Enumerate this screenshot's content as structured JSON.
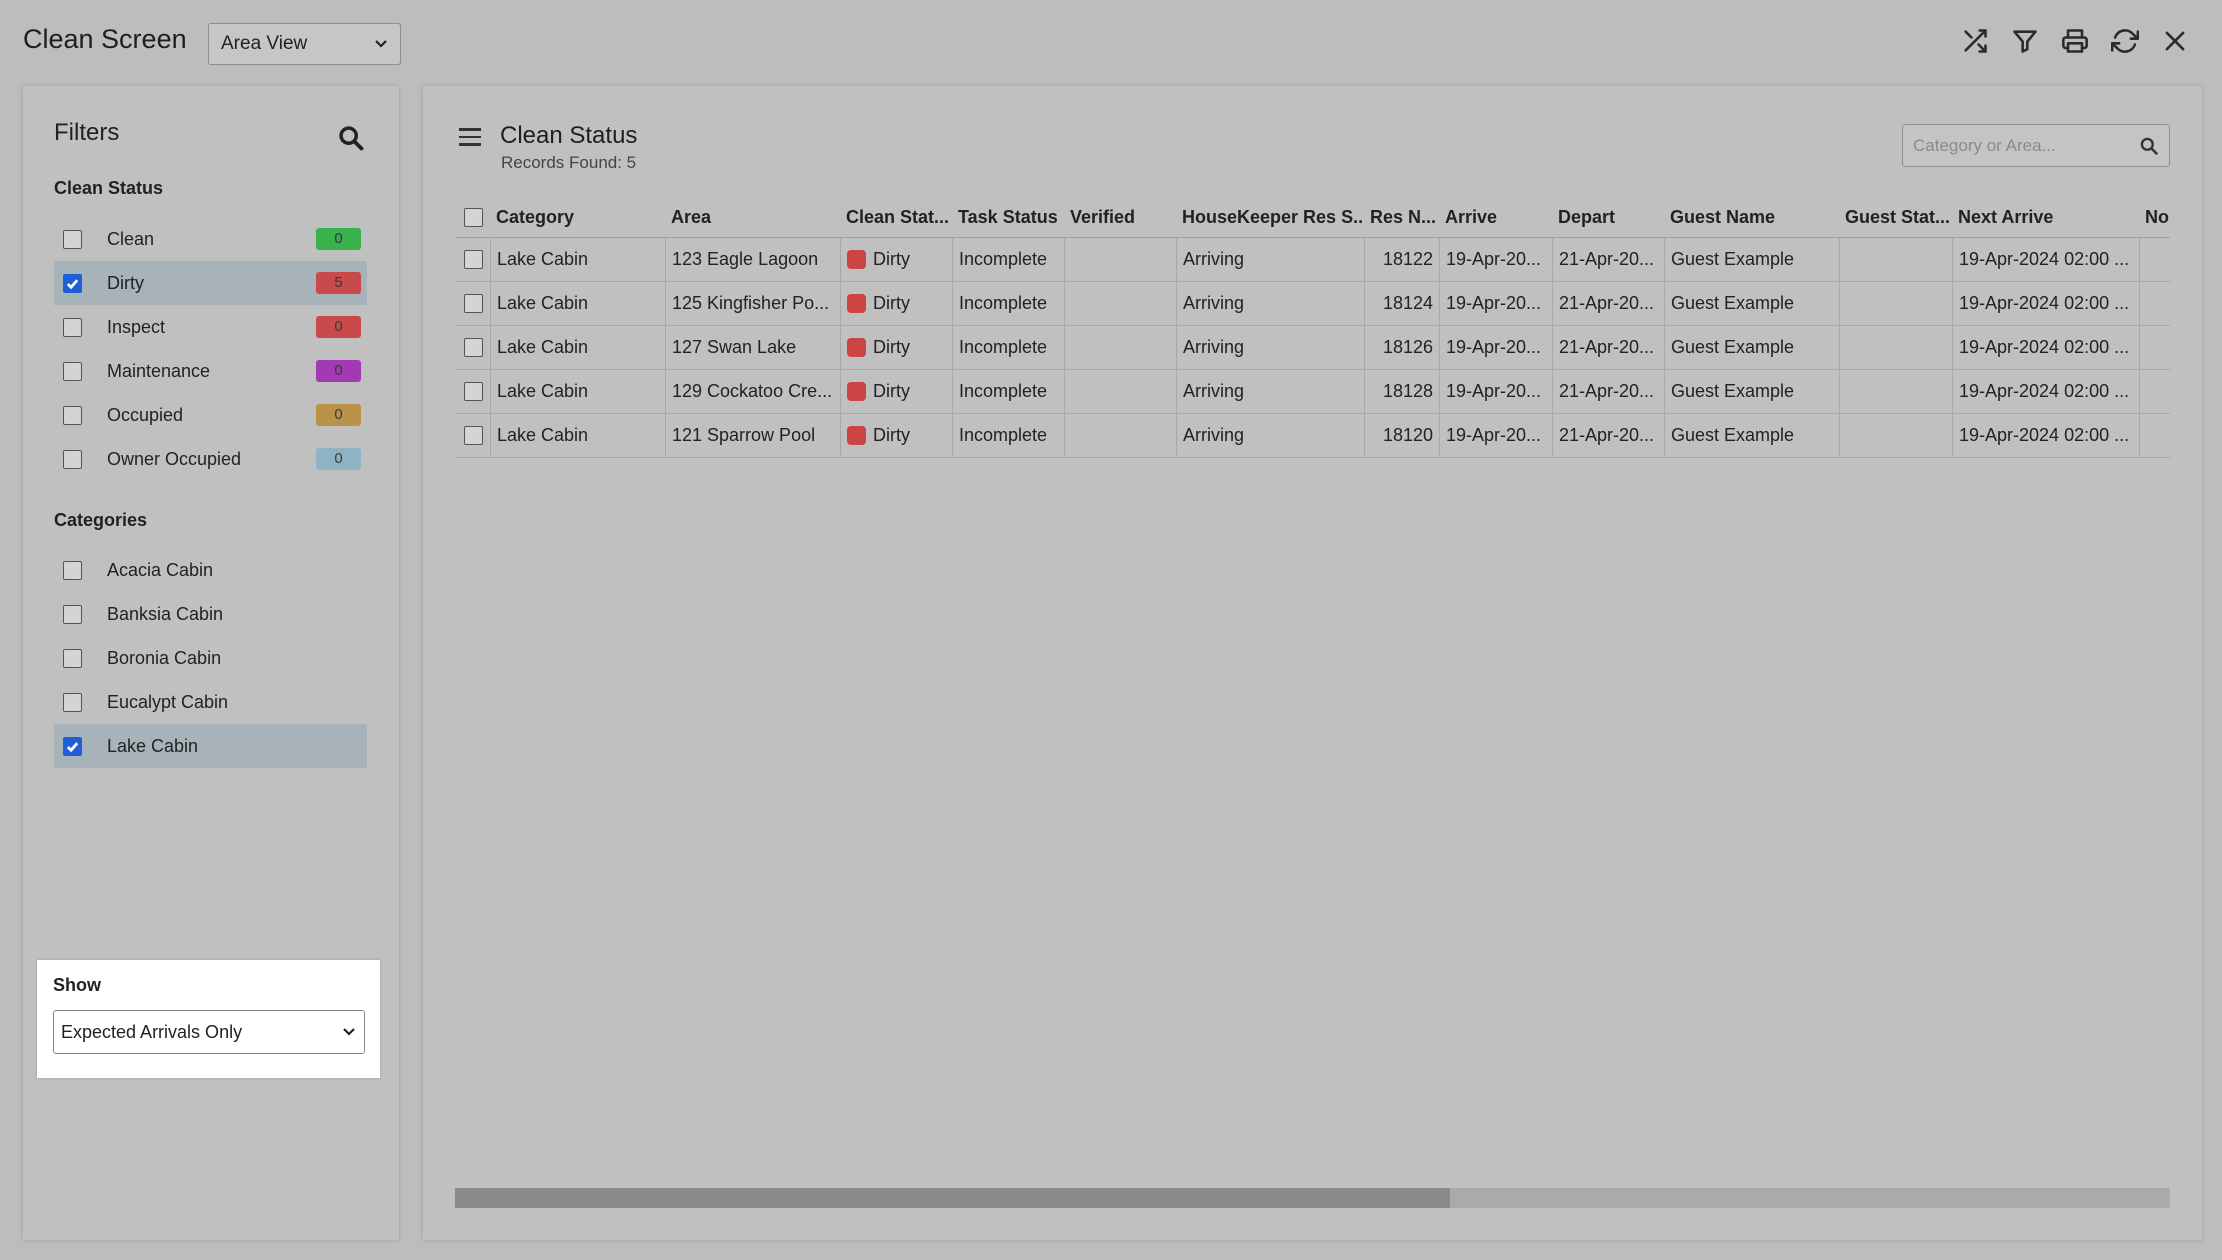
{
  "app": {
    "title": "Clean Screen",
    "view_select": "Area View"
  },
  "toolbar": {
    "icons": [
      "shuffle-icon",
      "filter-icon",
      "print-icon",
      "refresh-icon",
      "close-icon"
    ]
  },
  "filters": {
    "title": "Filters",
    "clean_status_title": "Clean Status",
    "clean_status": [
      {
        "label": "Clean",
        "count": "0",
        "color": "#37b24d",
        "checked": false
      },
      {
        "label": "Dirty",
        "count": "5",
        "color": "#c84a4a",
        "checked": true
      },
      {
        "label": "Inspect",
        "count": "0",
        "color": "#c84a4a",
        "checked": false
      },
      {
        "label": "Maintenance",
        "count": "0",
        "color": "#a23bb3",
        "checked": false
      },
      {
        "label": "Occupied",
        "count": "0",
        "color": "#b99448",
        "checked": false
      },
      {
        "label": "Owner Occupied",
        "count": "0",
        "color": "#8fb3c4",
        "checked": false
      }
    ],
    "categories_title": "Categories",
    "categories": [
      {
        "label": "Acacia Cabin",
        "checked": false
      },
      {
        "label": "Banksia Cabin",
        "checked": false
      },
      {
        "label": "Boronia Cabin",
        "checked": false
      },
      {
        "label": "Eucalypt Cabin",
        "checked": false
      },
      {
        "label": "Lake Cabin",
        "checked": true
      }
    ],
    "show_label": "Show",
    "show_value": "Expected Arrivals Only"
  },
  "main": {
    "title": "Clean Status",
    "records": "Records Found: 5",
    "search_placeholder": "Category or Area...",
    "columns": [
      "Category",
      "Area",
      "Clean Stat...",
      "Task Status",
      "Verified",
      "HouseKeeper Res S...",
      "Res N...",
      "Arrive",
      "Depart",
      "Guest Name",
      "Guest Stat...",
      "Next Arrive",
      "No"
    ],
    "rows": [
      [
        "Lake Cabin",
        "123 Eagle Lagoon",
        "Dirty",
        "Incomplete",
        "",
        "Arriving",
        "18122",
        "19-Apr-20...",
        "21-Apr-20...",
        "Guest Example",
        "",
        "19-Apr-2024 02:00 ...",
        ""
      ],
      [
        "Lake Cabin",
        "125 Kingfisher Po...",
        "Dirty",
        "Incomplete",
        "",
        "Arriving",
        "18124",
        "19-Apr-20...",
        "21-Apr-20...",
        "Guest Example",
        "",
        "19-Apr-2024 02:00 ...",
        ""
      ],
      [
        "Lake Cabin",
        "127 Swan Lake",
        "Dirty",
        "Incomplete",
        "",
        "Arriving",
        "18126",
        "19-Apr-20...",
        "21-Apr-20...",
        "Guest Example",
        "",
        "19-Apr-2024 02:00 ...",
        ""
      ],
      [
        "Lake Cabin",
        "129 Cockatoo Cre...",
        "Dirty",
        "Incomplete",
        "",
        "Arriving",
        "18128",
        "19-Apr-20...",
        "21-Apr-20...",
        "Guest Example",
        "",
        "19-Apr-2024 02:00 ...",
        ""
      ],
      [
        "Lake Cabin",
        "121 Sparrow Pool",
        "Dirty",
        "Incomplete",
        "",
        "Arriving",
        "18120",
        "19-Apr-20...",
        "21-Apr-20...",
        "Guest Example",
        "",
        "19-Apr-2024 02:00 ...",
        ""
      ]
    ],
    "status_color": "#cc4444",
    "scroll_fraction": 0.58
  }
}
